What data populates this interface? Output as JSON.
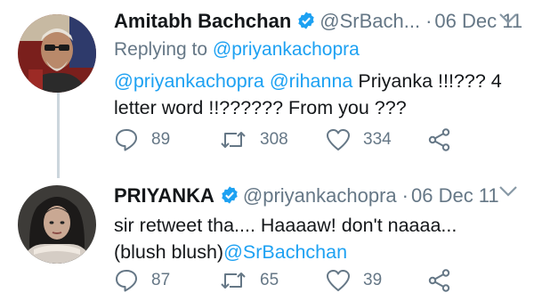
{
  "tweets": [
    {
      "author_name": "Amitabh Bachchan",
      "handle": "@SrBach...",
      "separator": "·",
      "date": "06 Dec 11",
      "replying_label": "Replying to",
      "replying_to": "@priyankachopra",
      "text_mention_1": "@priyankachopra",
      "text_mention_2": "@rihanna",
      "text_body": "Priyanka !!!??? 4 letter word !!?????? From you ???",
      "replies": "89",
      "retweets": "308",
      "likes": "334",
      "icons": [
        "verified-badge-icon",
        "chevron-down-icon",
        "reply-icon",
        "retweet-icon",
        "heart-icon",
        "share-icon"
      ]
    },
    {
      "author_name": "PRIYANKA",
      "handle": "@priyankachopra",
      "separator": "·",
      "date": "06 Dec 11",
      "text_body": "sir retweet tha.... Haaaaw! don't naaaa...(blush blush)",
      "text_mention": "@SrBachchan",
      "replies": "87",
      "retweets": "65",
      "likes": "39",
      "icons": [
        "verified-badge-icon",
        "chevron-down-icon",
        "reply-icon",
        "retweet-icon",
        "heart-icon",
        "share-icon"
      ]
    }
  ],
  "colors": {
    "text": "#14171a",
    "muted": "#657786",
    "link": "#1da1f2",
    "verified": "#1da1f2",
    "thread_line": "#ccd6dd"
  }
}
